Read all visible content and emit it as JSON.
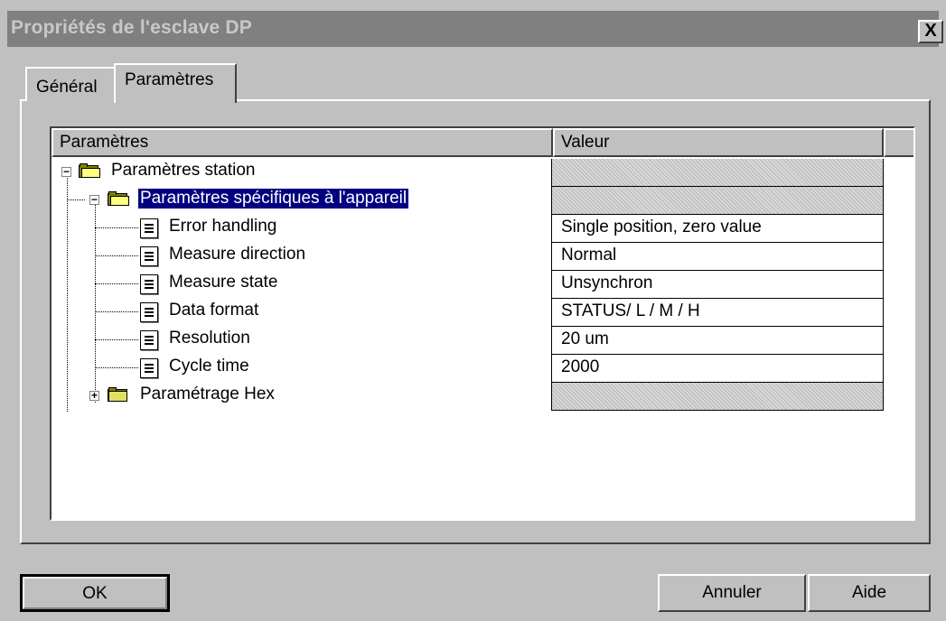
{
  "window": {
    "title": "Propriétés de l'esclave DP",
    "close_label": "X"
  },
  "tabs": [
    {
      "label": "Général",
      "active": false
    },
    {
      "label": "Paramètres",
      "active": true
    }
  ],
  "grid": {
    "columns": [
      "Paramètres",
      "Valeur"
    ],
    "rows": [
      {
        "label": "Paramètres station",
        "value": "",
        "icon": "folder-open-icon",
        "expander": "minus"
      },
      {
        "label": "Paramètres spécifiques à l'appareil",
        "value": "",
        "icon": "folder-open-icon",
        "expander": "minus",
        "selected": true
      },
      {
        "label": "Error handling",
        "value": "Single position, zero value",
        "icon": "document-icon"
      },
      {
        "label": "Measure direction",
        "value": "Normal",
        "icon": "document-icon"
      },
      {
        "label": "Measure state",
        "value": "Unsynchron",
        "icon": "document-icon"
      },
      {
        "label": "Data format",
        "value": "STATUS/ L / M / H",
        "icon": "document-icon"
      },
      {
        "label": "Resolution",
        "value": "20 um",
        "icon": "document-icon"
      },
      {
        "label": "Cycle time",
        "value": "2000",
        "icon": "document-icon"
      },
      {
        "label": "Paramétrage Hex",
        "value": "",
        "icon": "folder-closed-icon",
        "expander": "plus"
      }
    ]
  },
  "buttons": {
    "ok": "OK",
    "cancel": "Annuler",
    "help": "Aide"
  }
}
